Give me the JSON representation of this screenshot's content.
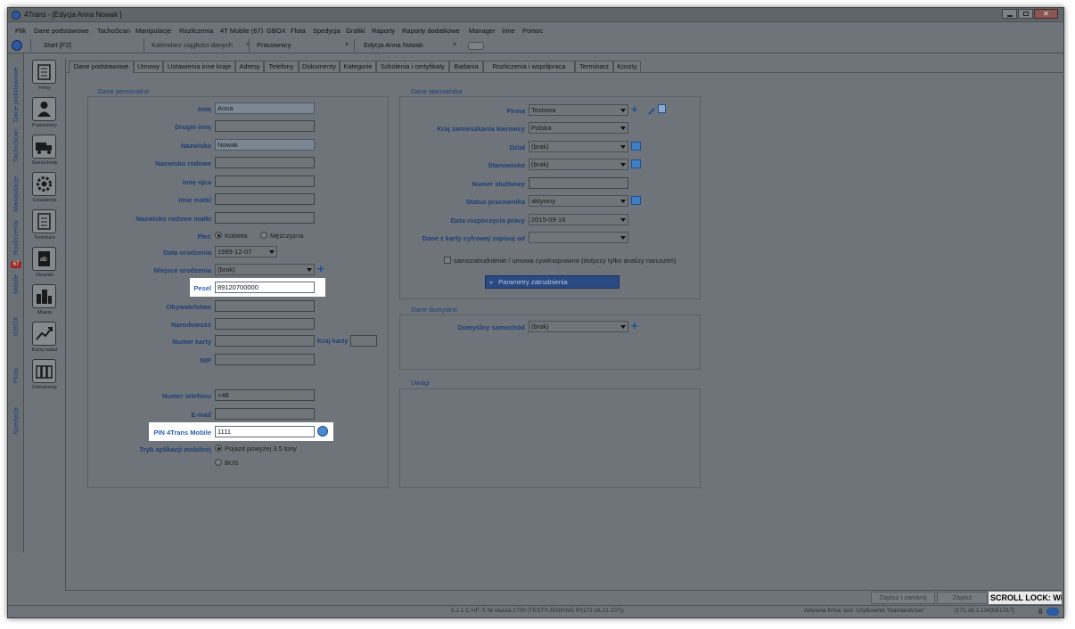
{
  "window": {
    "title": "4Trans - [Edycja   Anna Nowak   ]",
    "controls": [
      "minimize-icon",
      "maximize-icon",
      "close-icon"
    ]
  },
  "menu": [
    "Plik",
    "Dane podstawowe",
    "TachoScan",
    "Manipulacje",
    "Rozliczenia",
    "4T Mobile (67)",
    "GBOX",
    "Flota",
    "Spedycja",
    "Grafiki",
    "Raporty",
    "Raporty dodatkowe",
    "Manager",
    "Inne",
    "Pomoc"
  ],
  "doc_tabs": [
    "Start [F2]",
    "Kalendarz ciągłości danych",
    "Pracownicy",
    "Edycja Anna Nowak"
  ],
  "side_vtabs": [
    "Dane podstawowe",
    "TachoScan",
    "Manipulacje",
    "Rozliczenia",
    "Mobile",
    "GBOX",
    "Flota",
    "Spedycja"
  ],
  "mobile_badge": "67",
  "side_items": [
    "Firmy",
    "Pracownicy",
    "Samochody",
    "Ustawienia",
    "Terminarz",
    "Słowniki",
    "Miasta",
    "Kursy walut",
    "Dokumenty"
  ],
  "form_tabs": [
    "Dane podstawowe",
    "Umowy",
    "Ustawienia inne kraje",
    "Adresy",
    "Telefony",
    "Dokumenty",
    "Kategorie",
    "Szkolenia i certyfikaty",
    "Badania",
    "Rozliczenia i współpraca",
    "Terminarz",
    "Koszty"
  ],
  "personal": {
    "title": "Dane personalne",
    "imie_label": "Imię",
    "imie": "Anna",
    "drugie_label": "Drugie imię",
    "drugie": "",
    "nazwisko_label": "Nazwisko",
    "nazwisko": "Nowak",
    "nazwisko_rod_label": "Nazwisko rodowe",
    "nazwisko_rod": "",
    "imie_ojca_label": "Imię ojca",
    "imie_ojca": "",
    "imie_matki_label": "Imię matki",
    "imie_matki": "",
    "nazwisko_matki_label": "Nazwisko rodowe matki",
    "nazwisko_matki": "",
    "plec_label": "Płeć",
    "plec_k": "Kobieta",
    "plec_m": "Mężczyzna",
    "data_ur_label": "Data urodzenia",
    "data_ur": "1989-12-07",
    "miejsce_label": "Miejsce urodzenia",
    "miejsce": "(brak)",
    "pesel_label": "Pesel",
    "pesel": "89120700000",
    "obyw_label": "Obywatelstwo",
    "obyw": "",
    "narod_label": "Narodowość",
    "narod": "",
    "karta_label": "Numer karty",
    "karta": "",
    "kraj_karty_label": "Kraj karty",
    "kraj_karty": "",
    "nip_label": "NIP",
    "nip": "",
    "tel_label": "Numer telefonu",
    "tel": "+48",
    "email_label": "E-mail",
    "email": "",
    "pin_label": "PIN 4Trans Mobile",
    "pin": "1111",
    "tryb_label": "Tryb aplikacji mobilnej",
    "tryb_1": "Pojazd powyżej 3.5 tony",
    "tryb_2": "BUS"
  },
  "position": {
    "title": "Dane stanowiska",
    "firma_label": "Firma",
    "firma": "Testowa",
    "kraj_label": "Kraj zamieszkania kierowcy",
    "kraj": "Polska",
    "dzial_label": "Dział",
    "dzial": "(brak)",
    "stan_label": "Stanowisko",
    "stan": "(brak)",
    "numer_label": "Numer służbowy",
    "numer": "",
    "status_label": "Status pracownika",
    "status": "aktywny",
    "data_rozp_label": "Data rozpoczęcia pracy",
    "data_rozp": "2015-09-16",
    "karta_cyfr_label": "Dane z karty cyfrowej zapisuj od",
    "karta_cyfr": "",
    "samozatr": "samozatrudnienie / umowa cywilnoprawna (dotyczy tylko analizy naruszeń)",
    "params_btn": "Parametry zatrudnienia"
  },
  "defaults": {
    "title": "Dane domyślne",
    "samochod_label": "Domyślny samochód",
    "samochod": "(brak)"
  },
  "notes": {
    "title": "Uwagi"
  },
  "footer": {
    "save_close": "Zapisz i zamknij",
    "save": "Zapisz",
    "scroll_lock": "SCROLL LOCK: WŁ",
    "version": "5.2.1 C HF: 5    Nr klucza:1700 (TESTY-JENKINS IP(172.16.21.107))",
    "firm": "Aktywna firma: test",
    "user": "Użytkownik 'StandardUser'",
    "ip": "[172.16.1.134]NEL017]",
    "count": "6"
  }
}
